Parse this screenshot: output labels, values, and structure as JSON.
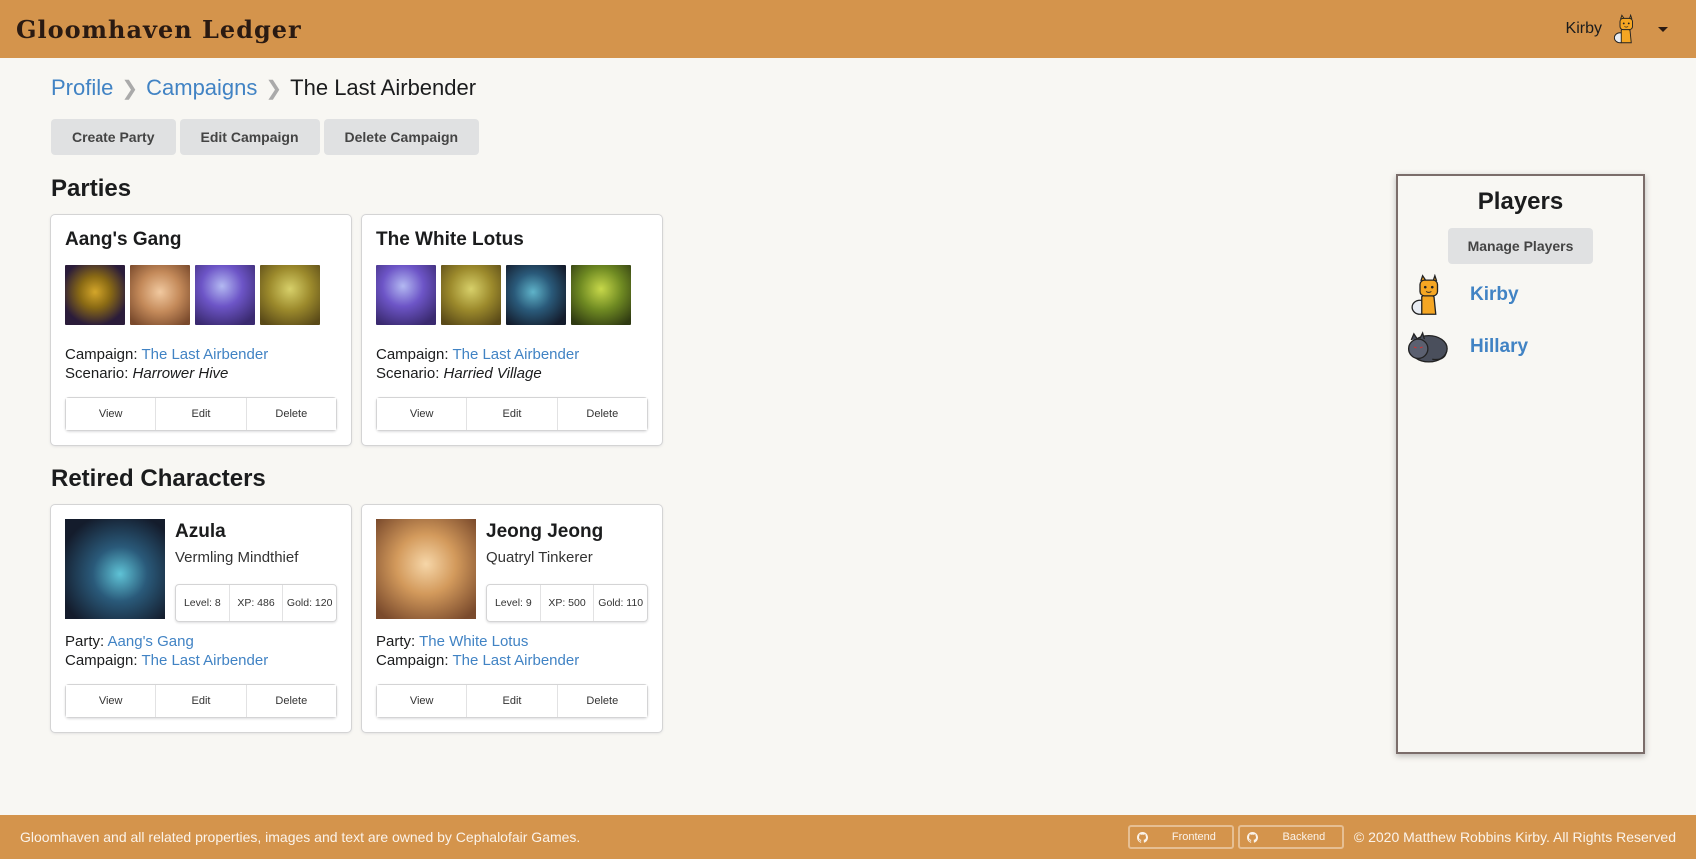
{
  "header": {
    "brand": "Gloomhaven Ledger",
    "user_name": "Kirby",
    "user_avatar": "fox-avatar-icon"
  },
  "breadcrumb": {
    "items": [
      "Profile",
      "Campaigns"
    ],
    "active": "The Last Airbender"
  },
  "actions": {
    "create_party": "Create Party",
    "edit_campaign": "Edit Campaign",
    "delete_campaign": "Delete Campaign"
  },
  "parties": {
    "title": "Parties",
    "items": [
      {
        "name": "Aang's Gang",
        "portraits": [
          "brute-portrait",
          "tinkerer-portrait",
          "spellweaver-portrait",
          "inox-portrait"
        ],
        "campaign_label": "Campaign:",
        "campaign": "The Last Airbender",
        "scenario_label": "Scenario:",
        "scenario": "Harrower Hive"
      },
      {
        "name": "The White Lotus",
        "portraits": [
          "spellweaver-portrait",
          "inox-portrait",
          "mindthief-portrait",
          "scoundrel-portrait"
        ],
        "campaign_label": "Campaign:",
        "campaign": "The Last Airbender",
        "scenario_label": "Scenario:",
        "scenario": "Harried Village"
      }
    ]
  },
  "retired": {
    "title": "Retired Characters",
    "items": [
      {
        "name": "Azula",
        "class": "Vermling Mindthief",
        "level": "Level: 8",
        "xp": "XP: 486",
        "gold": "Gold: 120",
        "party_label": "Party:",
        "party": "Aang's Gang",
        "campaign_label": "Campaign:",
        "campaign": "The Last Airbender"
      },
      {
        "name": "Jeong Jeong",
        "class": "Quatryl Tinkerer",
        "level": "Level: 9",
        "xp": "XP: 500",
        "gold": "Gold: 110",
        "party_label": "Party:",
        "party": "The White Lotus",
        "campaign_label": "Campaign:",
        "campaign": "The Last Airbender"
      }
    ]
  },
  "card_buttons": {
    "view": "View",
    "edit": "Edit",
    "delete": "Delete"
  },
  "players": {
    "title": "Players",
    "manage": "Manage Players",
    "items": [
      {
        "name": "Kirby",
        "avatar": "fox-avatar-icon"
      },
      {
        "name": "Hillary",
        "avatar": "sleeping-cat-avatar-icon"
      }
    ]
  },
  "footer": {
    "notice": "Gloomhaven and all related properties, images and text are owned by Cephalofair Games.",
    "frontend": "Frontend",
    "backend": "Backend",
    "copyright": "2020 Matthew Robbins Kirby. All Rights Reserved"
  },
  "colors": {
    "brand_bar": "#d4944c",
    "background": "#f8f7f3",
    "link": "#4183c4",
    "button_bg": "#e0e1e2"
  }
}
